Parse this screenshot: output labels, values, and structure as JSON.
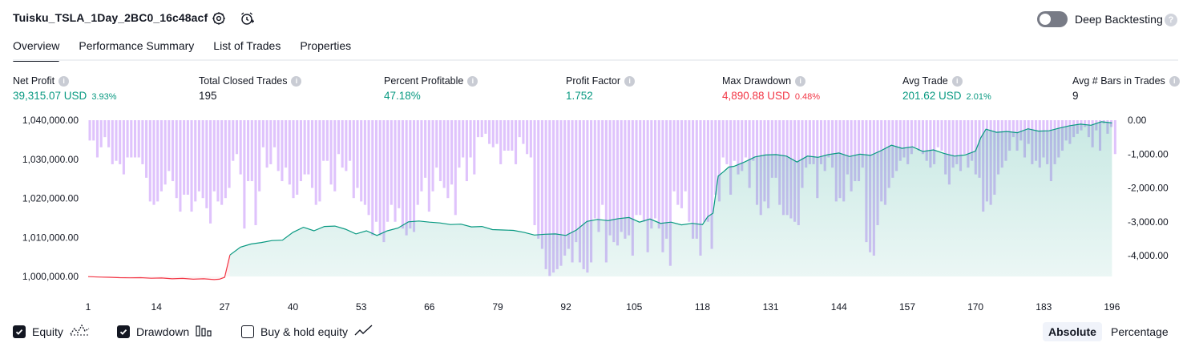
{
  "header": {
    "strategy_name": "Tuisku_TSLA_1Day_2BC0_16c48acf",
    "settings_icon": "gear-icon",
    "alert_icon": "alarm-clock-plus-icon",
    "deep_backtesting_label": "Deep Backtesting",
    "deep_backtesting_enabled": false,
    "help_icon": "?"
  },
  "tabs": [
    {
      "label": "Overview",
      "active": true
    },
    {
      "label": "Performance Summary",
      "active": false
    },
    {
      "label": "List of Trades",
      "active": false
    },
    {
      "label": "Properties",
      "active": false
    }
  ],
  "metrics": [
    {
      "label": "Net Profit",
      "value": "39,315.07 USD",
      "pct": "3.93%",
      "tone": "pos"
    },
    {
      "label": "Total Closed Trades",
      "value": "195",
      "pct": "",
      "tone": "neu"
    },
    {
      "label": "Percent Profitable",
      "value": "47.18%",
      "pct": "",
      "tone": "pos"
    },
    {
      "label": "Profit Factor",
      "value": "1.752",
      "pct": "",
      "tone": "pos"
    },
    {
      "label": "Max Drawdown",
      "value": "4,890.88 USD",
      "pct": "0.48%",
      "tone": "neg"
    },
    {
      "label": "Avg Trade",
      "value": "201.62 USD",
      "pct": "2.01%",
      "tone": "pos"
    },
    {
      "label": "Avg # Bars in Trades",
      "value": "9",
      "pct": "",
      "tone": "neu"
    }
  ],
  "info_icon": "i",
  "colors": {
    "equity_up": "#089981",
    "equity_down": "#f23645",
    "equity_fill": "#d6f0e9",
    "drawdown_bar": "#d9b8fb",
    "text": "#131722"
  },
  "chart_data": {
    "type": "line",
    "x_ticks": [
      "1",
      "14",
      "27",
      "40",
      "53",
      "66",
      "79",
      "92",
      "105",
      "118",
      "131",
      "144",
      "157",
      "170",
      "183",
      "196"
    ],
    "left_axis": {
      "ticks": [
        "1,040,000.00",
        "1,030,000.00",
        "1,020,000.00",
        "1,010,000.00",
        "1,000,000.00"
      ],
      "ylim": [
        1000000,
        1040000
      ]
    },
    "right_axis": {
      "ticks": [
        "0.00",
        "-1,000.00",
        "-2,000.00",
        "-3,000.00",
        "-4,000.00"
      ],
      "ylim": [
        -4600,
        0
      ]
    },
    "equity": {
      "name": "Equity",
      "x": [
        1,
        3,
        5,
        7,
        9,
        11,
        13,
        15,
        17,
        19,
        21,
        23,
        25,
        26,
        27,
        28,
        30,
        32,
        34,
        36,
        38,
        40,
        42,
        44,
        46,
        48,
        50,
        52,
        54,
        56,
        58,
        60,
        62,
        64,
        66,
        68,
        70,
        72,
        74,
        76,
        78,
        80,
        82,
        84,
        86,
        88,
        90,
        92,
        94,
        96,
        98,
        100,
        102,
        104,
        106,
        108,
        110,
        112,
        114,
        116,
        118,
        119,
        120,
        121,
        122,
        123,
        124,
        126,
        128,
        130,
        132,
        134,
        136,
        138,
        140,
        142,
        144,
        146,
        148,
        150,
        152,
        154,
        156,
        158,
        160,
        162,
        164,
        166,
        168,
        170,
        171,
        172,
        174,
        176,
        178,
        180,
        182,
        184,
        186,
        188,
        190,
        192,
        194,
        196
      ],
      "values": [
        999950,
        999850,
        999800,
        999700,
        999650,
        999700,
        999550,
        999600,
        999400,
        999500,
        999300,
        999400,
        999200,
        999300,
        999800,
        1005500,
        1007500,
        1008300,
        1008700,
        1009200,
        1009300,
        1011300,
        1012600,
        1011700,
        1012800,
        1012900,
        1012100,
        1010900,
        1011700,
        1010500,
        1011700,
        1012400,
        1014000,
        1014200,
        1013900,
        1013700,
        1013300,
        1013400,
        1012700,
        1012800,
        1012000,
        1011900,
        1011800,
        1011300,
        1010600,
        1010800,
        1010900,
        1010500,
        1011900,
        1014100,
        1014600,
        1014300,
        1014800,
        1015100,
        1013900,
        1014700,
        1013600,
        1013900,
        1013200,
        1013600,
        1013300,
        1015300,
        1016200,
        1025700,
        1026800,
        1028000,
        1028200,
        1029300,
        1030600,
        1031100,
        1031200,
        1030800,
        1029300,
        1030800,
        1030500,
        1031200,
        1031600,
        1030700,
        1031300,
        1031000,
        1032200,
        1033600,
        1032800,
        1033200,
        1032000,
        1032400,
        1031500,
        1030800,
        1031100,
        1032100,
        1035500,
        1037700,
        1036900,
        1037100,
        1036800,
        1037800,
        1037200,
        1037300,
        1038000,
        1038600,
        1039000,
        1038700,
        1039600,
        1039300
      ]
    },
    "drawdown": {
      "name": "Drawdown",
      "values": [
        -600,
        -600,
        -1100,
        -800,
        -500,
        -800,
        -1300,
        -1200,
        -1300,
        -1600,
        -1100,
        -1100,
        -1100,
        -1100,
        -1300,
        -1700,
        -2400,
        -2500,
        -2400,
        -2100,
        -1900,
        -1500,
        -1800,
        -2300,
        -2700,
        -2200,
        -2200,
        -2700,
        -2400,
        -2100,
        -2300,
        -2600,
        -3050,
        -2100,
        -2400,
        -2500,
        -2300,
        -2000,
        -1200,
        -1000,
        -1600,
        -3200,
        -1800,
        -1800,
        -3100,
        -2100,
        -800,
        -1400,
        -1300,
        -800,
        -1500,
        -1800,
        -1400,
        -1900,
        -2300,
        -2200,
        -1800,
        -1600,
        -1600,
        -2000,
        -2500,
        -2400,
        -1200,
        -1200,
        -1900,
        -2100,
        -1000,
        -1400,
        -1500,
        -1200,
        -2300,
        -2000,
        -2400,
        -2500,
        -2800,
        -3400,
        -3000,
        -3400,
        -3600,
        -3000,
        -2500,
        -3000,
        -2600,
        -3200,
        -3400,
        -3200,
        -3300,
        -2500,
        -2100,
        -1700,
        -2700,
        -2100,
        -1400,
        -1800,
        -2000,
        -2300,
        -1900,
        -2800,
        -1400,
        -1100,
        -1800,
        -1100,
        -1600,
        -500,
        -500,
        -400,
        -700,
        -800,
        -700,
        -1300,
        -900,
        -900,
        -900,
        -1300,
        -500,
        -700,
        -1000,
        -1100,
        -3100,
        -3500,
        -3800,
        -4400,
        -4600,
        -4500,
        -4400,
        -4300,
        -4000,
        -3800,
        -4200,
        -3600,
        -4200,
        -4400,
        -4500,
        -4200,
        -2900,
        -3300,
        -2500,
        -4200,
        -3400,
        -3600,
        -3700,
        -3300,
        -3500,
        -3400,
        -4000,
        -2800,
        -2800,
        -3000,
        -3900,
        -3200,
        -2900,
        -3200,
        -3900,
        -3500,
        -4300,
        -2100,
        -2500,
        -2600,
        -2100,
        -3000,
        -3500,
        -3500,
        -4000,
        -3000,
        -3000,
        -3800,
        -2200,
        -2400,
        -1100,
        -1300,
        -2200,
        -1200,
        -1600,
        -1500,
        -1100,
        -2000,
        -1200,
        -2500,
        -2800,
        -2400,
        -2600,
        -1700,
        -1700,
        -2500,
        -2800,
        -2800,
        -2900,
        -3000,
        -3100,
        -2000,
        -1400,
        -1300,
        -1300,
        -2300,
        -1300,
        -1500,
        -1100,
        -1400,
        -2400,
        -2300,
        -2400,
        -1600,
        -2100,
        -1800,
        -1800,
        -1400,
        -3600,
        -3900,
        -4000,
        -3100,
        -2400,
        -2500,
        -2000,
        -1700,
        -1500,
        -1200,
        -1100,
        -1300,
        -1000,
        -800,
        -900,
        -1000,
        -1200,
        -1400,
        -1300,
        -800,
        -900,
        -1600,
        -1900,
        -1400,
        -1300,
        -1500,
        -1000,
        -1400,
        -1200,
        -1600,
        -1700,
        -2700,
        -2400,
        -2500,
        -2200,
        -1600,
        -1400,
        -1200,
        -900,
        -500,
        -900,
        -600,
        -1100,
        -700,
        -1300,
        -1200,
        -1400,
        -1100,
        -1300,
        -1800,
        -1300,
        -1100,
        -900,
        -600,
        -700,
        -500,
        -400,
        -300,
        -200,
        -500,
        -800,
        -300,
        -900,
        -100,
        -400,
        -200,
        -1000
      ]
    },
    "grid": false
  },
  "legend": {
    "items": [
      {
        "label": "Equity",
        "checked": true,
        "icon": "equity-line-icon"
      },
      {
        "label": "Drawdown",
        "checked": true,
        "icon": "drawdown-bars-icon"
      },
      {
        "label": "Buy & hold equity",
        "checked": false,
        "icon": "buy-hold-line-icon"
      }
    ],
    "scale_options": [
      {
        "label": "Absolute",
        "active": true
      },
      {
        "label": "Percentage",
        "active": false
      }
    ]
  }
}
